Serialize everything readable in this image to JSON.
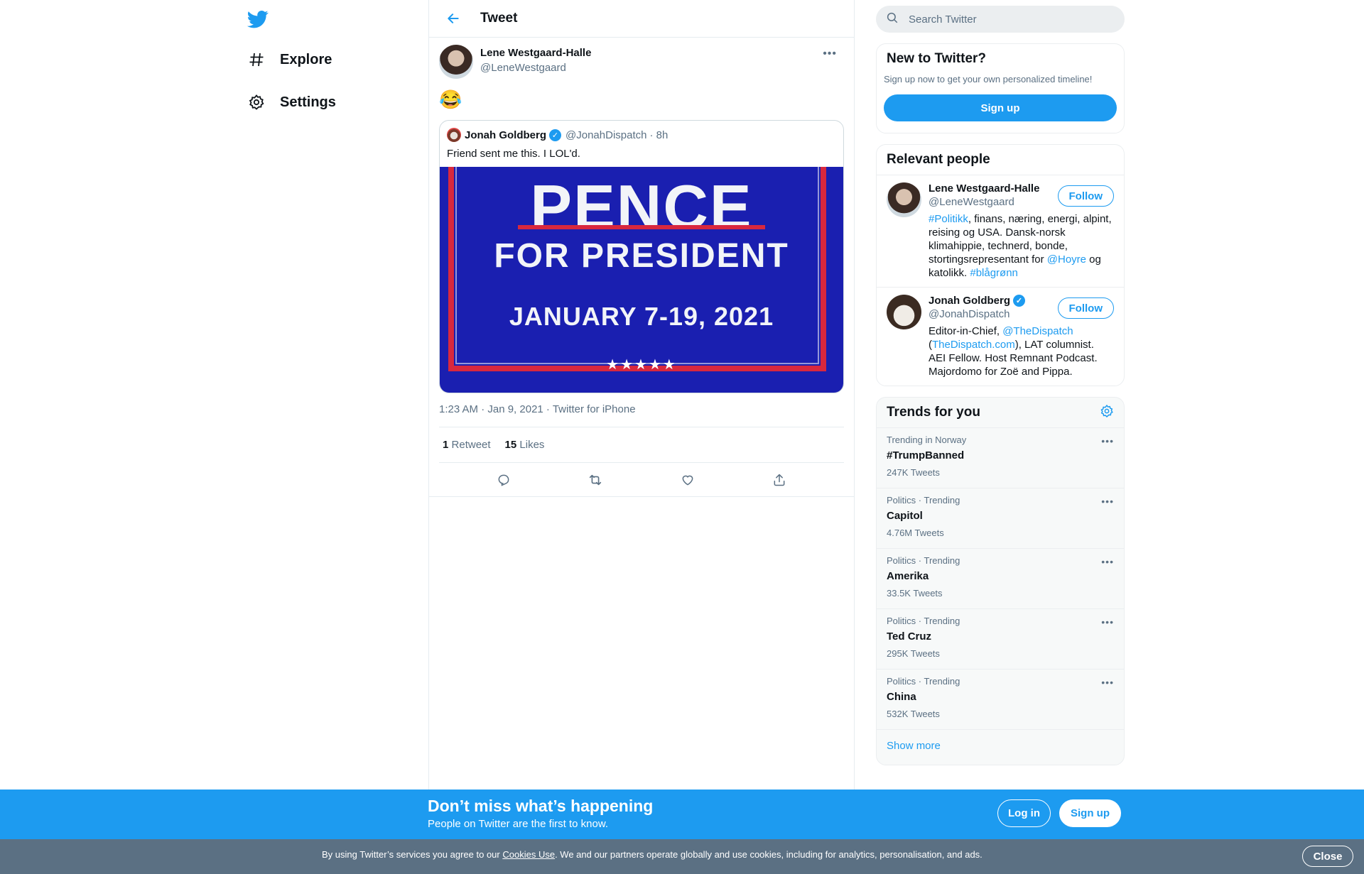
{
  "nav": {
    "logo": "twitter-bird-icon",
    "items": [
      {
        "label": "Explore",
        "icon": "hashtag-icon"
      },
      {
        "label": "Settings",
        "icon": "gear-icon"
      }
    ]
  },
  "header": {
    "title": "Tweet"
  },
  "tweet": {
    "author_name": "Lene Westgaard-Halle",
    "author_handle": "@LeneWestgaard",
    "text": "😂",
    "quoted": {
      "name": "Jonah Goldberg",
      "handle": "@JonahDispatch",
      "time": "· 8h",
      "text": "Friend sent me this. I LOL'd.",
      "image": {
        "line1": "PENCE",
        "line2": "FOR PRESIDENT",
        "line3": "JANUARY 7-19, 2021",
        "stars": "★★★★★"
      }
    },
    "meta": "1:23 AM · Jan 9, 2021 · Twitter for iPhone",
    "retweets": {
      "count": "1",
      "label": "Retweet"
    },
    "likes": {
      "count": "15",
      "label": "Likes"
    }
  },
  "search": {
    "placeholder": "Search Twitter"
  },
  "new_to_twitter": {
    "title": "New to Twitter?",
    "subtitle": "Sign up now to get your own personalized timeline!",
    "button": "Sign up"
  },
  "relevant": {
    "title": "Relevant people",
    "people": [
      {
        "name": "Lene Westgaard-Halle",
        "handle": "@LeneWestgaard",
        "follow": "Follow",
        "bio": [
          {
            "t": "#Politikk",
            "link": true
          },
          {
            "t": ", finans, næring, energi, alpint, reising og USA. Dansk-norsk klimahippie, technerd, bonde, stortingsrepresentant for ",
            "link": false
          },
          {
            "t": "@Hoyre",
            "link": true
          },
          {
            "t": " og katolikk. ",
            "link": false
          },
          {
            "t": "#blågrønn",
            "link": true
          }
        ]
      },
      {
        "name": "Jonah Goldberg",
        "handle": "@JonahDispatch",
        "follow": "Follow",
        "bio": [
          {
            "t": "Editor-in-Chief, ",
            "link": false
          },
          {
            "t": "@TheDispatch",
            "link": true
          },
          {
            "t": " (",
            "link": false
          },
          {
            "t": "TheDispatch.com",
            "link": true
          },
          {
            "t": "), LAT columnist. AEI Fellow. Host Remnant Podcast. Majordomo for Zoë and Pippa.",
            "link": false
          }
        ]
      }
    ]
  },
  "trends": {
    "title": "Trends for you",
    "items": [
      {
        "context": "Trending in Norway",
        "name": "#TrumpBanned",
        "count": "247K Tweets"
      },
      {
        "context": "Politics · Trending",
        "name": "Capitol",
        "count": "4.76M Tweets"
      },
      {
        "context": "Politics · Trending",
        "name": "Amerika",
        "count": "33.5K Tweets"
      },
      {
        "context": "Politics · Trending",
        "name": "Ted Cruz",
        "count": "295K Tweets"
      },
      {
        "context": "Politics · Trending",
        "name": "China",
        "count": "532K Tweets"
      }
    ],
    "show_more": "Show more"
  },
  "banner": {
    "title": "Don’t miss what’s happening",
    "subtitle": "People on Twitter are the first to know.",
    "login": "Log in",
    "signup": "Sign up"
  },
  "cookie": {
    "prefix": "By using Twitter’s services you agree to our ",
    "link": "Cookies Use",
    "suffix": ". We and our partners operate globally and use cookies, including for analytics, personalisation, and ads.",
    "close": "Close"
  },
  "colors": {
    "accent": "#1d9bf0",
    "cookie_bar": "#5b7083"
  }
}
